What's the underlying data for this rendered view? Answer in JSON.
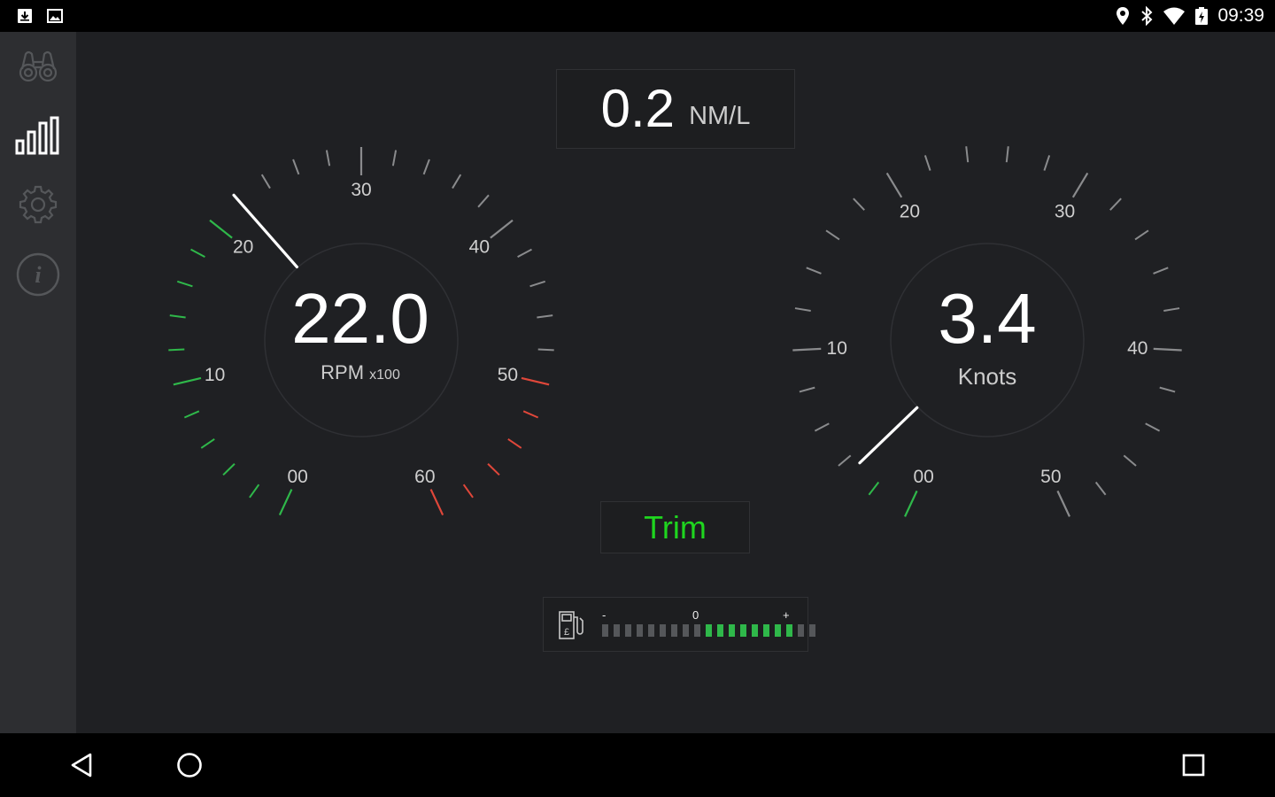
{
  "status_bar": {
    "time": "09:39",
    "left_icons": [
      "download-icon",
      "image-icon"
    ],
    "right_icons": [
      "location-icon",
      "bluetooth-icon",
      "wifi-icon",
      "battery-charging-icon"
    ]
  },
  "sidebar": {
    "items": [
      {
        "icon": "binoculars-icon",
        "active": false
      },
      {
        "icon": "bar-chart-icon",
        "active": true
      },
      {
        "icon": "gear-icon",
        "active": false
      },
      {
        "icon": "info-icon",
        "active": false
      }
    ]
  },
  "economy": {
    "value": "0.2",
    "unit": "NM/L"
  },
  "rpm_gauge": {
    "value": "22.0",
    "label": "RPM",
    "multiplier": "x100",
    "needle_value": 22,
    "scale_labels": [
      "00",
      "10",
      "20",
      "30",
      "40",
      "50",
      "60"
    ],
    "scale_max": 60,
    "green_max": 22,
    "red_min": 50
  },
  "speed_gauge": {
    "value": "3.4",
    "label": "Knots",
    "needle_value": 3.4,
    "scale_labels": [
      "00",
      "10",
      "20",
      "30",
      "40",
      "50"
    ],
    "scale_max": 50,
    "green_max": 3.4
  },
  "trim": {
    "label": "Trim",
    "color": "#1fd51f"
  },
  "fuel_trim": {
    "minus": "-",
    "zero": "0",
    "plus": "+",
    "segments_total": 19,
    "segments_active": [
      9,
      10,
      11,
      12,
      13,
      14,
      15,
      16
    ]
  },
  "colors": {
    "green": "#2fb84a",
    "red": "#e0473a",
    "tick": "#8a8b8d",
    "trim_green": "#1fd51f"
  },
  "nav_bar": {
    "buttons": [
      "back-icon",
      "home-icon",
      "recents-icon"
    ]
  }
}
